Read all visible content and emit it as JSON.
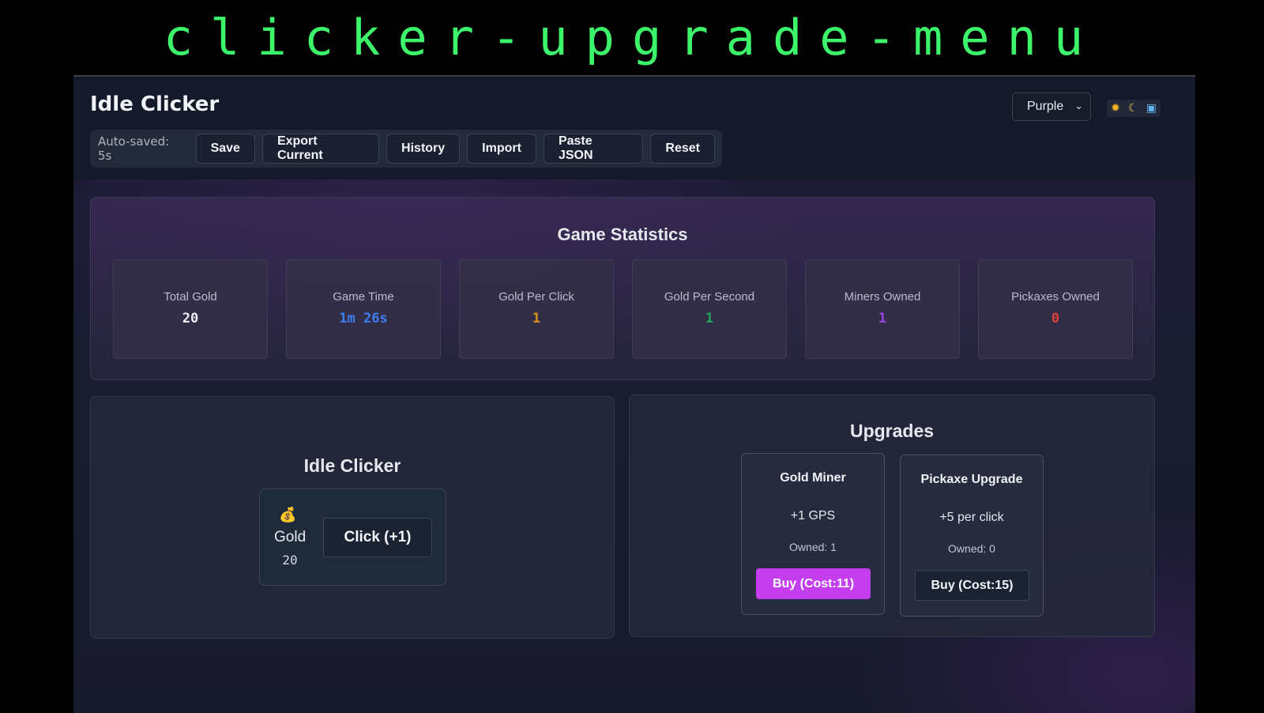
{
  "banner": {
    "title": "clicker-upgrade-menu"
  },
  "header": {
    "title": "Idle Clicker",
    "autosave": "Auto-saved: 5s",
    "buttons": {
      "save": "Save",
      "export": "Export Current",
      "history": "History",
      "import": "Import",
      "paste": "Paste JSON",
      "reset": "Reset"
    },
    "theme": {
      "selected": "Purple",
      "chevron": "⌄"
    },
    "mode_icons": {
      "light": "sun-icon",
      "dark": "moon-icon",
      "system": "laptop-icon",
      "light_glyph": "✹",
      "dark_glyph": "☾",
      "system_glyph": "▣"
    }
  },
  "stats": {
    "title": "Game Statistics",
    "items": [
      {
        "label": "Total Gold",
        "value": "20",
        "color": "#eef0f4"
      },
      {
        "label": "Game Time",
        "value": "1m 26s",
        "color": "#3f7ef2"
      },
      {
        "label": "Gold Per Click",
        "value": "1",
        "color": "#d9921e"
      },
      {
        "label": "Gold Per Second",
        "value": "1",
        "color": "#27a35a"
      },
      {
        "label": "Miners Owned",
        "value": "1",
        "color": "#9a47e6"
      },
      {
        "label": "Pickaxes Owned",
        "value": "0",
        "color": "#e0403e"
      }
    ]
  },
  "clicker": {
    "title": "Idle Clicker",
    "coin_icon": "money-bag-icon",
    "coin_glyph": "💰",
    "gold_label": "Gold",
    "gold_value": "20",
    "click_label": "Click (+1)"
  },
  "upgrades": {
    "title": "Upgrades",
    "items": [
      {
        "name": "Gold Miner",
        "effect": "+1 GPS",
        "owned": "Owned: 1",
        "buy": "Buy (Cost:11)",
        "affordable": true
      },
      {
        "name": "Pickaxe Upgrade",
        "effect": "+5 per click",
        "owned": "Owned: 0",
        "buy": "Buy (Cost:15)",
        "affordable": false
      }
    ]
  },
  "colors": {
    "accent": "#c43ef0",
    "banner_text": "#3cf56a"
  }
}
